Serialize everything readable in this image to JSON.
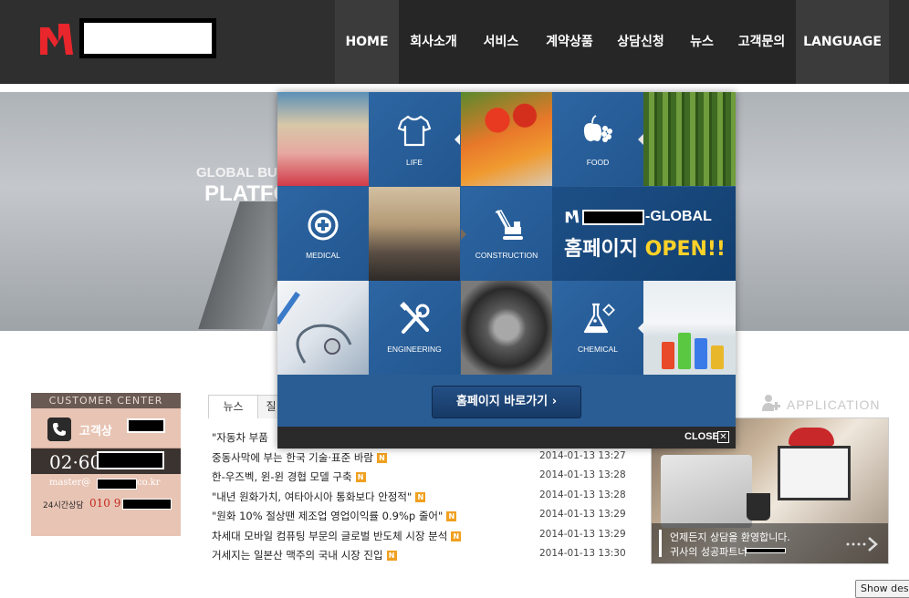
{
  "header": {
    "nav": [
      {
        "label": "HOME"
      },
      {
        "label": "회사소개"
      },
      {
        "label": "서비스"
      },
      {
        "label": "계약상품"
      },
      {
        "label": "상담신청"
      },
      {
        "label": "뉴스"
      },
      {
        "label": "고객문의"
      },
      {
        "label": "LANGUAGE"
      }
    ]
  },
  "hero": {
    "subtitle": "GLOBAL BUS",
    "title": "PLATFO"
  },
  "customer_center": {
    "heading": "CUSTOMER CENTER",
    "label": "고객상",
    "phone_prefix": "02·60",
    "email_prefix": "master@",
    "email_suffix": "co.kr",
    "hours": "24시간상담",
    "mobile_prefix": "010 9"
  },
  "news": {
    "tabs": [
      "뉴스",
      "질"
    ],
    "items": [
      {
        "title": "\"자동차 부품",
        "date": "",
        "new": false
      },
      {
        "title": "중동사막에 부는 한국 기술·표준 바람",
        "date": "2014-01-13 13:27",
        "new": true
      },
      {
        "title": "한-우즈벡, 윈-윈 경협 모델 구축",
        "date": "2014-01-13 13:28",
        "new": true
      },
      {
        "title": "\"내년 원화가치, 여타아시아 통화보다 안정적\"",
        "date": "2014-01-13 13:28",
        "new": true
      },
      {
        "title": "\"원화 10% 절상땐 제조업 영업이익률 0.9%p 줄어\"",
        "date": "2014-01-13 13:29",
        "new": true
      },
      {
        "title": "차세대 모바일 컴퓨팅 부문의 글로벌 반도체 시장 분석",
        "date": "2014-01-13 13:29",
        "new": true
      },
      {
        "title": "거세지는 일본산 맥주의 국내 시장 진입",
        "date": "2014-01-13 13:30",
        "new": true
      }
    ],
    "new_badge": "N"
  },
  "application": {
    "title": "APPLICATION",
    "caption_line1": "언제든지 상담을 환영합니다.",
    "caption_line2": "귀사의 성공파트너"
  },
  "popup": {
    "tiles": {
      "life": "LIFE",
      "food": "FOOD",
      "medical": "MEDICAL",
      "construction": "CONSTRUCTION",
      "engineering": "ENGINEERING",
      "chemical": "CHEMICAL"
    },
    "banner_suffix": "-GLOBAL",
    "banner_home": "홈페이지 ",
    "banner_open": "OPEN!!",
    "button_label": "홈페이지 바로가기",
    "close_label": "CLOSE",
    "close_glyph": "✕"
  },
  "system": {
    "show_desktop": "Show desk"
  },
  "colors": {
    "header_bg": "#2f2f2f",
    "popup_blue": "#2a5d94",
    "accent_red": "#e8262c",
    "open_yellow": "#ffd228"
  }
}
